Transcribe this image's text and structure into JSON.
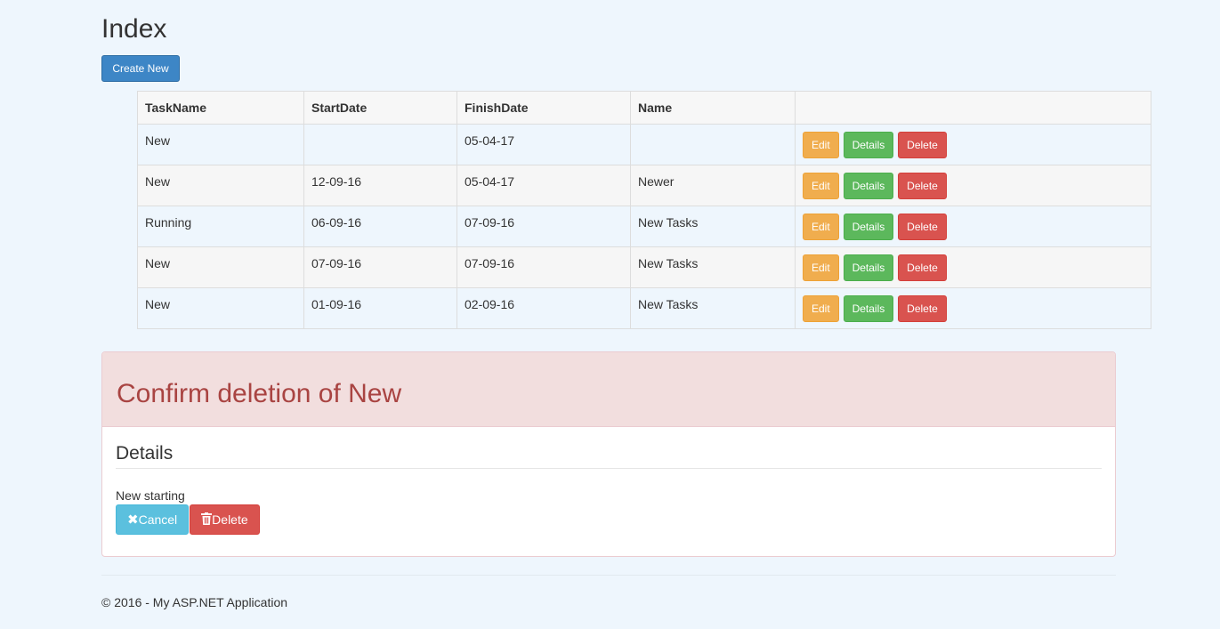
{
  "page": {
    "title": "Index",
    "create_label": "Create New"
  },
  "table": {
    "headers": [
      "TaskName",
      "StartDate",
      "FinishDate",
      "Name",
      ""
    ],
    "rows": [
      {
        "task_name": "New",
        "start_date": "",
        "finish_date": "05-04-17",
        "name": ""
      },
      {
        "task_name": "New",
        "start_date": "12-09-16",
        "finish_date": "05-04-17",
        "name": "Newer"
      },
      {
        "task_name": "Running",
        "start_date": "06-09-16",
        "finish_date": "07-09-16",
        "name": "New Tasks"
      },
      {
        "task_name": "New",
        "start_date": "07-09-16",
        "finish_date": "07-09-16",
        "name": "New Tasks"
      },
      {
        "task_name": "New",
        "start_date": "01-09-16",
        "finish_date": "02-09-16",
        "name": "New Tasks"
      }
    ],
    "actions": {
      "edit_label": "Edit",
      "details_label": "Details",
      "delete_label": "Delete"
    }
  },
  "confirm_panel": {
    "title": "Confirm deletion of New",
    "details_heading": "Details",
    "detail_text": "New starting",
    "cancel_label": "Cancel",
    "cancel_icon": "remove-icon",
    "delete_label": "Delete",
    "delete_icon": "trash-icon"
  },
  "footer": {
    "text": "© 2016 - My ASP.NET Application"
  },
  "colors": {
    "background": "#eef6fd",
    "primary": "#3d86c6",
    "warning": "#f0ad4e",
    "success": "#5cb85c",
    "danger": "#d9534f",
    "info": "#5bc0de",
    "danger_heading_bg": "#f2dede",
    "danger_heading_text": "#a94442"
  }
}
